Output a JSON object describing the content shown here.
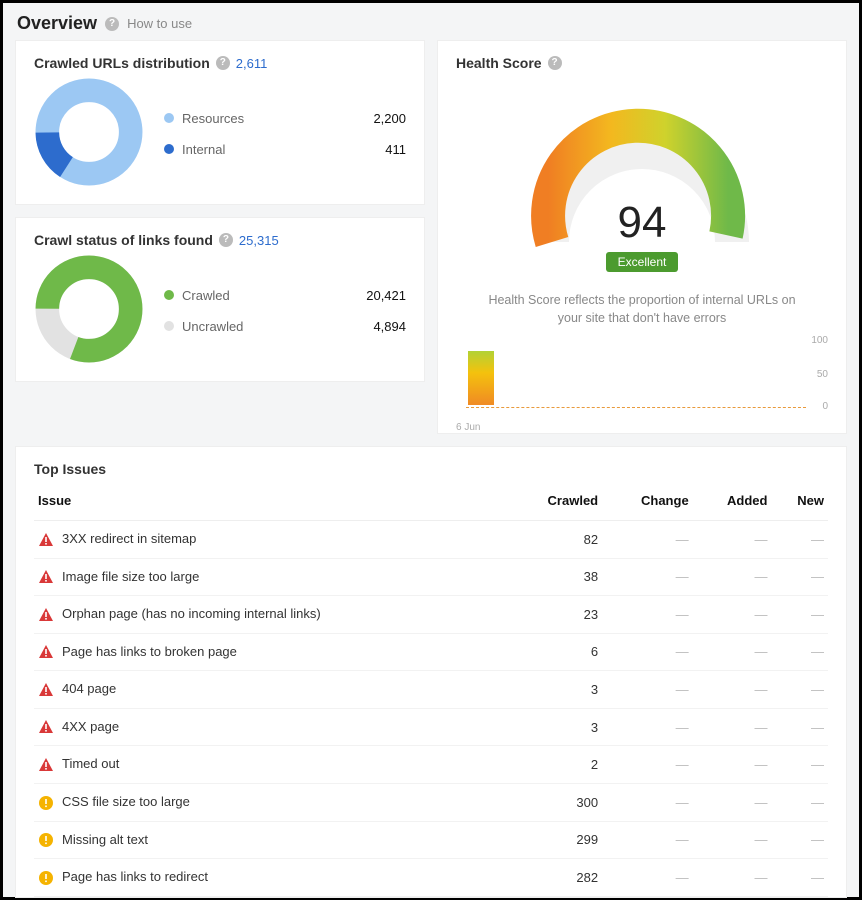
{
  "header": {
    "title": "Overview",
    "how_to_use": "How to use"
  },
  "crawled_urls": {
    "title": "Crawled URLs distribution",
    "total": "2,611",
    "legend": [
      {
        "label": "Resources",
        "value": "2,200",
        "color": "#9cc8f3"
      },
      {
        "label": "Internal",
        "value": "411",
        "color": "#2d6ccd"
      }
    ]
  },
  "crawl_status": {
    "title": "Crawl status of links found",
    "total": "25,315",
    "legend": [
      {
        "label": "Crawled",
        "value": "20,421",
        "color": "#6fb949"
      },
      {
        "label": "Uncrawled",
        "value": "4,894",
        "color": "#e2e2e2"
      }
    ]
  },
  "health": {
    "title": "Health Score",
    "score": "94",
    "badge": "Excellent",
    "desc": "Health Score reflects the proportion of internal URLs on your site that don't have errors",
    "mini": {
      "y100": "100",
      "y50": "50",
      "y0": "0",
      "xlabel": "6 Jun",
      "value": 94
    }
  },
  "colors": {
    "error": "#d93838",
    "warning": "#f5b300"
  },
  "top_issues": {
    "title": "Top Issues",
    "headers": {
      "issue": "Issue",
      "crawled": "Crawled",
      "change": "Change",
      "added": "Added",
      "new": "New"
    },
    "rows": [
      {
        "severity": "error",
        "label": "3XX redirect in sitemap",
        "crawled": "82",
        "change": "—",
        "added": "—",
        "new": "—"
      },
      {
        "severity": "error",
        "label": "Image file size too large",
        "crawled": "38",
        "change": "—",
        "added": "—",
        "new": "—"
      },
      {
        "severity": "error",
        "label": "Orphan page (has no incoming internal links)",
        "crawled": "23",
        "change": "—",
        "added": "—",
        "new": "—"
      },
      {
        "severity": "error",
        "label": "Page has links to broken page",
        "crawled": "6",
        "change": "—",
        "added": "—",
        "new": "—"
      },
      {
        "severity": "error",
        "label": "404 page",
        "crawled": "3",
        "change": "—",
        "added": "—",
        "new": "—"
      },
      {
        "severity": "error",
        "label": "4XX page",
        "crawled": "3",
        "change": "—",
        "added": "—",
        "new": "—"
      },
      {
        "severity": "error",
        "label": "Timed out",
        "crawled": "2",
        "change": "—",
        "added": "—",
        "new": "—"
      },
      {
        "severity": "warning",
        "label": "CSS file size too large",
        "crawled": "300",
        "change": "—",
        "added": "—",
        "new": "—"
      },
      {
        "severity": "warning",
        "label": "Missing alt text",
        "crawled": "299",
        "change": "—",
        "added": "—",
        "new": "—"
      },
      {
        "severity": "warning",
        "label": "Page has links to redirect",
        "crawled": "282",
        "change": "—",
        "added": "—",
        "new": "—"
      }
    ]
  },
  "chart_data": [
    {
      "type": "pie",
      "title": "Crawled URLs distribution",
      "categories": [
        "Resources",
        "Internal"
      ],
      "values": [
        2200,
        411
      ],
      "colors": [
        "#9cc8f3",
        "#2d6ccd"
      ],
      "total": 2611,
      "donut": true
    },
    {
      "type": "pie",
      "title": "Crawl status of links found",
      "categories": [
        "Crawled",
        "Uncrawled"
      ],
      "values": [
        20421,
        4894
      ],
      "colors": [
        "#6fb949",
        "#e2e2e2"
      ],
      "total": 25315,
      "donut": true
    },
    {
      "type": "bar",
      "title": "Health Score over time",
      "categories": [
        "6 Jun"
      ],
      "values": [
        94
      ],
      "ylim": [
        0,
        100
      ],
      "ylabel": "",
      "xlabel": ""
    }
  ]
}
